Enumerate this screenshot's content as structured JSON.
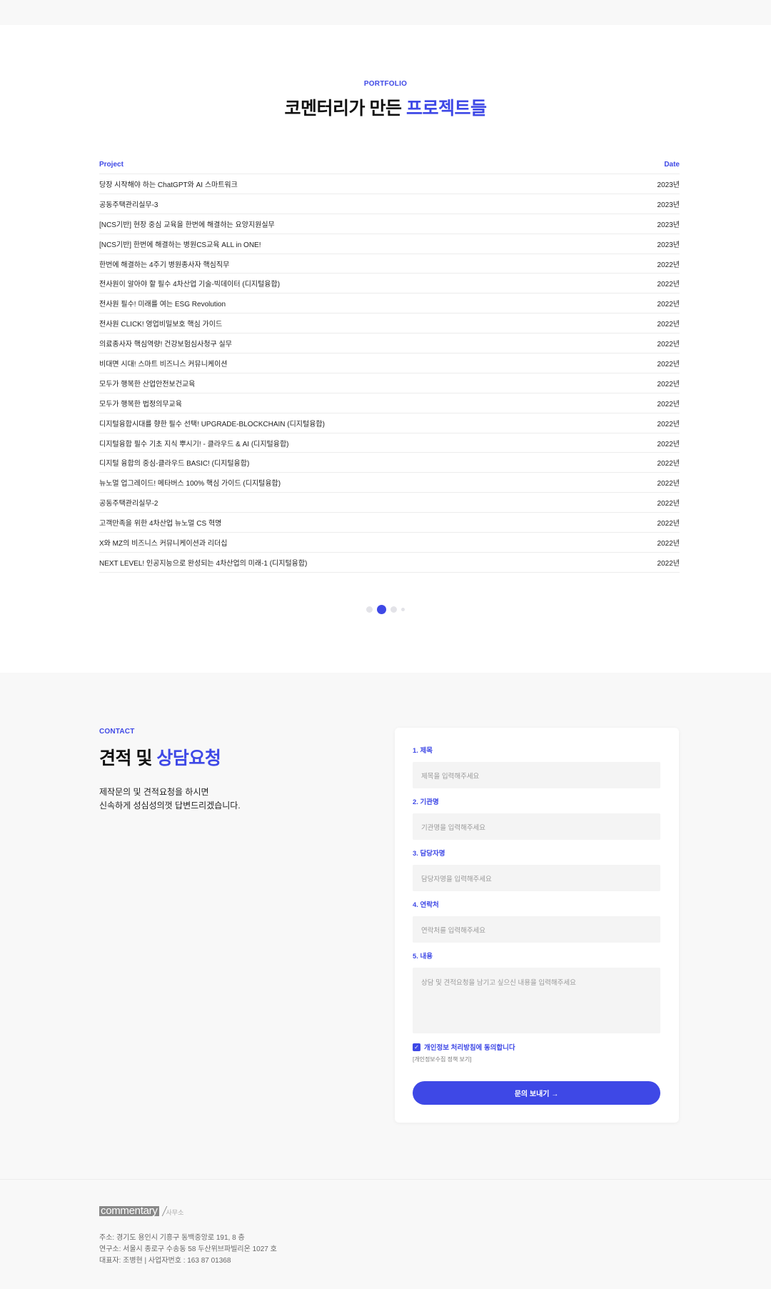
{
  "portfolio": {
    "eyebrow": "PORTFOLIO",
    "title_plain": "코멘터리가 만든 ",
    "title_accent": "프로젝트들",
    "col_project": "Project",
    "col_date": "Date",
    "rows": [
      {
        "project": "당장 시작해야 하는 ChatGPT와 AI 스마트워크",
        "date": "2023년"
      },
      {
        "project": "공동주택관리실무-3",
        "date": "2023년"
      },
      {
        "project": "[NCS기반] 현장 중심 교육을 한번에 해결하는 요양지원실무",
        "date": "2023년"
      },
      {
        "project": "[NCS기반] 한번에 해결하는 병원CS교육 ALL in ONE!",
        "date": "2023년"
      },
      {
        "project": "한번에 해결하는 4주기 병원종사자 핵심직무",
        "date": "2022년"
      },
      {
        "project": "전사원이 알아야 할 필수 4차산업 기술-빅데이터 (디지털융합)",
        "date": "2022년"
      },
      {
        "project": "전사원 필수! 미래를 여는 ESG Revolution",
        "date": "2022년"
      },
      {
        "project": "전사원 CLICK! 영업비밀보호 핵심 가이드",
        "date": "2022년"
      },
      {
        "project": "의료종사자 핵심역량! 건강보험심사청구 실무",
        "date": "2022년"
      },
      {
        "project": "비대면 시대! 스마트 비즈니스 커뮤니케이션",
        "date": "2022년"
      },
      {
        "project": "모두가 행복한 산업안전보건교육",
        "date": "2022년"
      },
      {
        "project": "모두가 행복한 법정의무교육",
        "date": "2022년"
      },
      {
        "project": "디지털융합시대를 향한 필수 선택! UPGRADE-BLOCKCHAIN (디지털융합)",
        "date": "2022년"
      },
      {
        "project": "디지털융합 필수 기초 지식 뿌시기! - 클라우드 & AI (디지털융합)",
        "date": "2022년"
      },
      {
        "project": "디지털 융합의 중심-클라우드 BASIC! (디지털융합)",
        "date": "2022년"
      },
      {
        "project": "뉴노멀 업그레이드! 메타버스 100% 핵심 가이드 (디지털융합)",
        "date": "2022년"
      },
      {
        "project": "공동주택관리실무-2",
        "date": "2022년"
      },
      {
        "project": "고객만족을 위한 4차산업 뉴노멀 CS 혁명",
        "date": "2022년"
      },
      {
        "project": "X와 MZ의 비즈니스 커뮤니케이션과 리더십",
        "date": "2022년"
      },
      {
        "project": "NEXT LEVEL! 인공지능으로 완성되는 4차산업의 미래-1 (디지털융합)",
        "date": "2022년"
      }
    ],
    "pagination": {
      "pages": 4,
      "active": 2
    }
  },
  "contact": {
    "eyebrow": "CONTACT",
    "title_plain": "견적 및 ",
    "title_accent": "상담요청",
    "desc_line1": "제작문의 및 견적요청을 하시면",
    "desc_line2": "신속하게 성심성의껏 답변드리겠습니다.",
    "fields": [
      {
        "label": "1. 제목",
        "placeholder": "제목을 입력해주세요"
      },
      {
        "label": "2. 기관명",
        "placeholder": "기관명을 입력해주세요"
      },
      {
        "label": "3. 담당자명",
        "placeholder": "담당자명을 입력해주세요"
      },
      {
        "label": "4. 연락처",
        "placeholder": "연락처를 입력해주세요"
      },
      {
        "label": "5. 내용",
        "placeholder": "상담 및 견적요청을 남기고 싶으신 내용을 입력해주세요"
      }
    ],
    "agree_label": "개인정보 처리방침에 동의합니다",
    "agree_checked": true,
    "policy_link": "[개인정보수집 정책 보기]",
    "submit_label": "문의 보내기 →"
  },
  "footer": {
    "logo_main": "commentary",
    "logo_sub": "사무소",
    "address": "주소: 경기도 용인시 기흥구 동백중앙로 191, 8 층",
    "lab": "연구소: 서울시 종로구 수송동 58 두산위브파빌리온 1027 호",
    "ceo": "대표자: 조병현 | 사업자번호 : 163 87 01368"
  },
  "colors": {
    "accent": "#3e48e6"
  }
}
